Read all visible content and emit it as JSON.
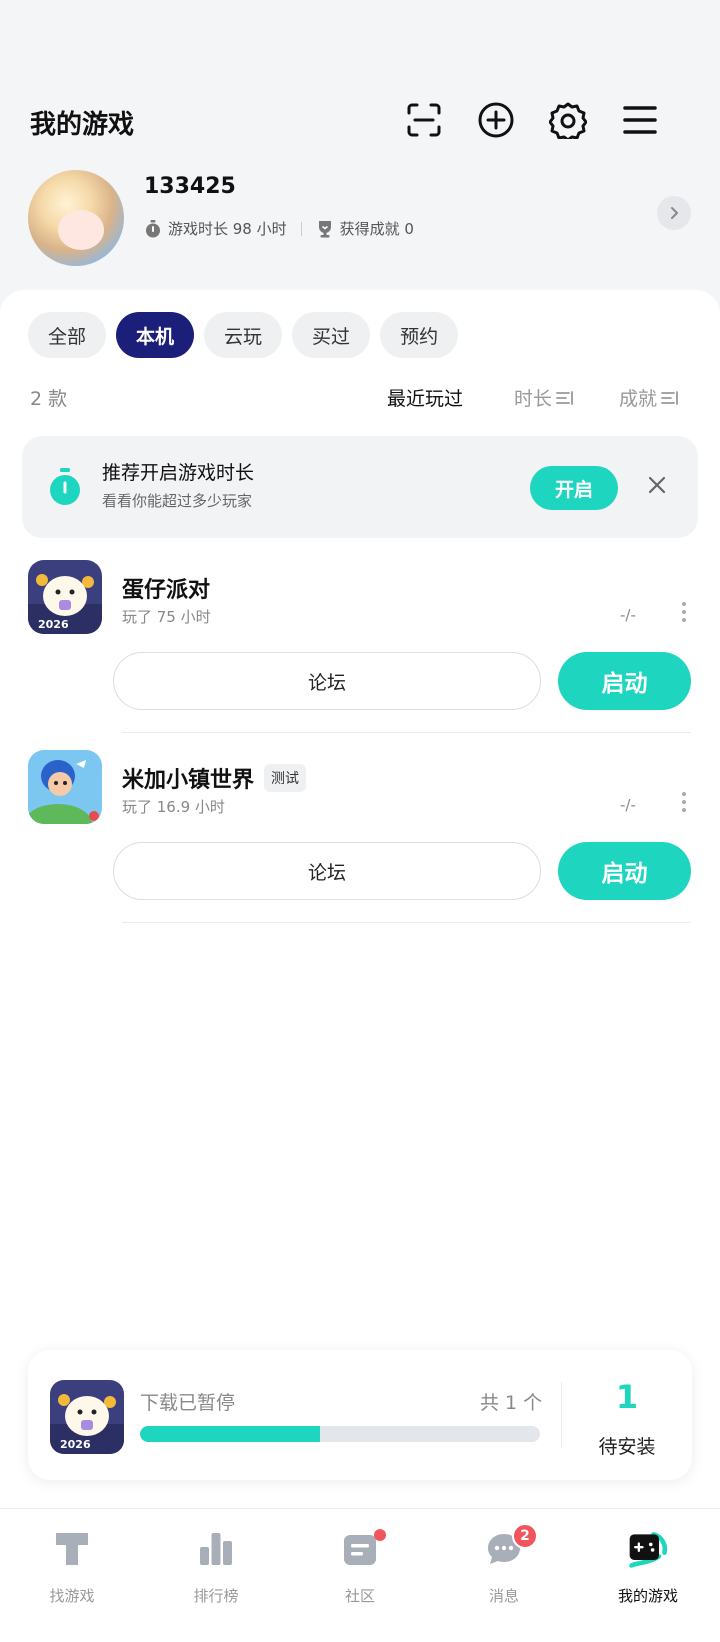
{
  "header": {
    "title": "我的游戏",
    "icons": [
      "scan-icon",
      "add-circle-icon",
      "gear-icon",
      "menu-icon"
    ]
  },
  "profile": {
    "username": "133425",
    "playtime_label": "游戏时长 98 小时",
    "achievements_label": "获得成就 0"
  },
  "filters": {
    "items": [
      {
        "label": "全部",
        "active": false
      },
      {
        "label": "本机",
        "active": true
      },
      {
        "label": "云玩",
        "active": false
      },
      {
        "label": "买过",
        "active": false
      },
      {
        "label": "预约",
        "active": false
      }
    ]
  },
  "list_header": {
    "count": "2 款",
    "sort_recent": "最近玩过",
    "sort_duration": "时长",
    "sort_achievement": "成就"
  },
  "recommend": {
    "title": "推荐开启游戏时长",
    "subtitle": "看看你能超过多少玩家",
    "button": "开启"
  },
  "games": [
    {
      "name": "蛋仔派对",
      "tag": "",
      "playtime": "玩了 75 小时",
      "achievement": "-/-",
      "forum": "论坛",
      "launch": "启动"
    },
    {
      "name": "米加小镇世界",
      "tag": "测试",
      "playtime": "玩了 16.9 小时",
      "achievement": "-/-",
      "forum": "论坛",
      "launch": "启动"
    }
  ],
  "download": {
    "status": "下载已暂停",
    "total": "共 1 个",
    "progress": 0.45,
    "pending_count": "1",
    "pending_label": "待安装"
  },
  "tabbar": {
    "items": [
      {
        "label": "找游戏",
        "icon": "find-games-icon"
      },
      {
        "label": "排行榜",
        "icon": "ranking-icon"
      },
      {
        "label": "社区",
        "icon": "community-icon"
      },
      {
        "label": "消息",
        "icon": "message-icon",
        "badge": "2"
      },
      {
        "label": "我的游戏",
        "icon": "my-games-icon"
      }
    ]
  },
  "colors": {
    "accent": "#1ed6bf",
    "active_chip": "#1b1f7a",
    "badge": "#f2545b"
  }
}
